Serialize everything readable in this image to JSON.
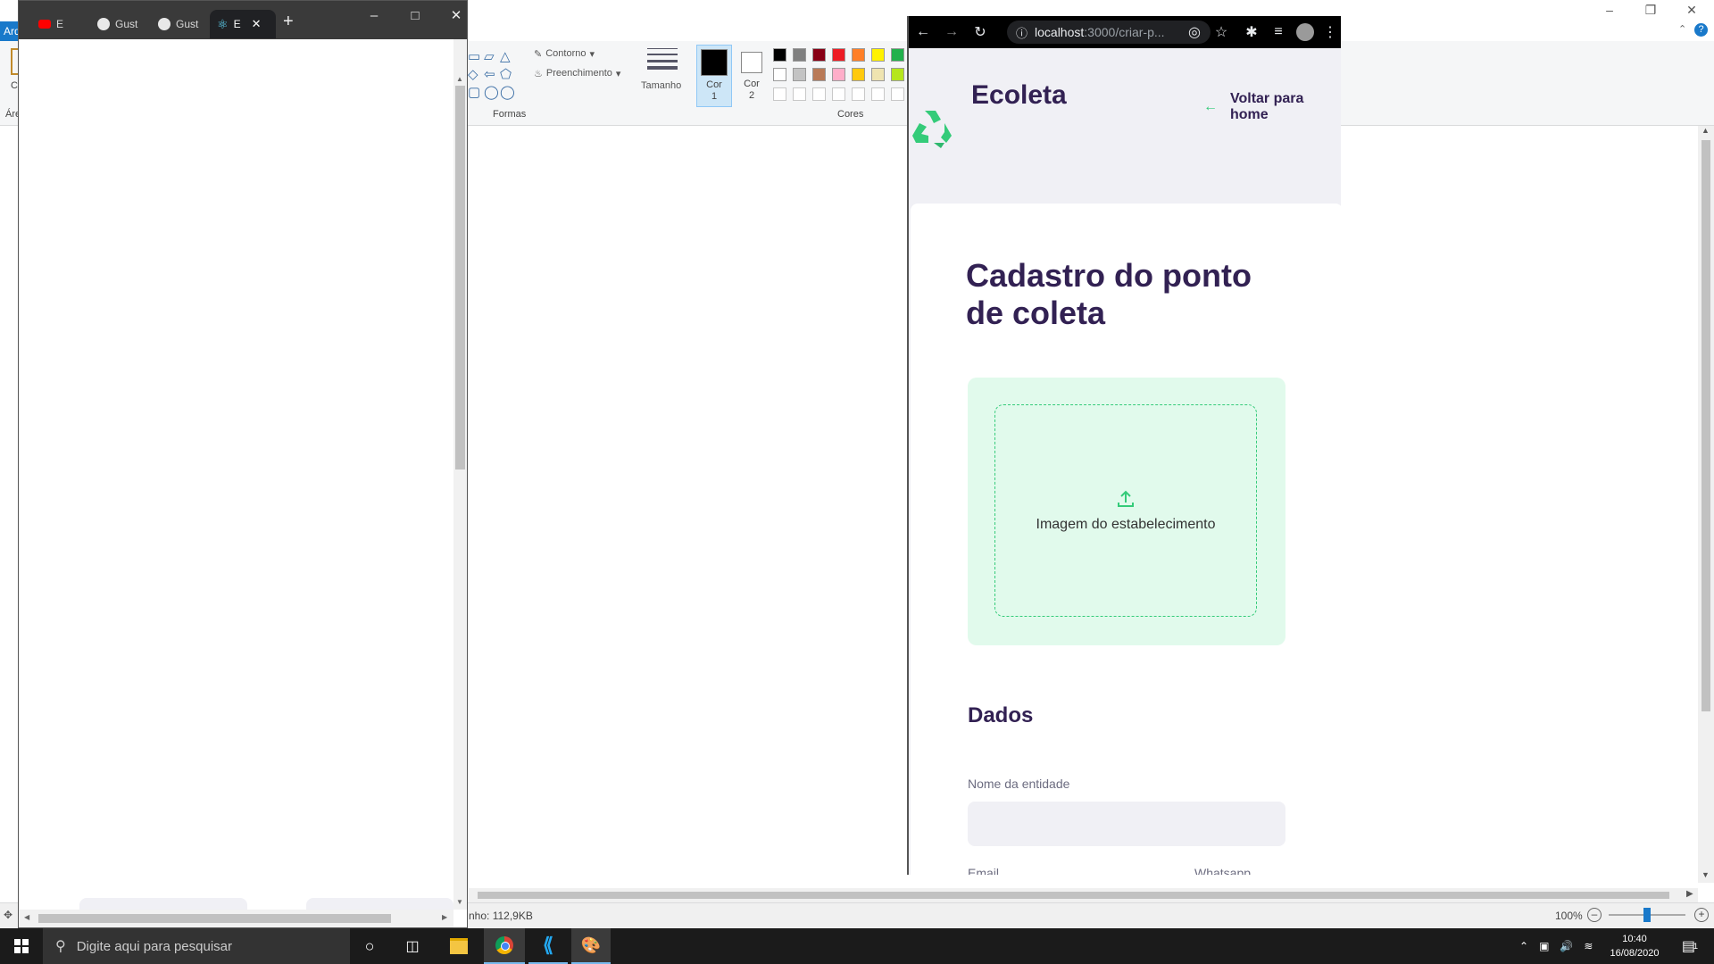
{
  "paint": {
    "file_tab": "Arq",
    "area_label": "Áre",
    "clip_letter": "C",
    "contour_label": "Contorno",
    "fill_label": "Preenchimento",
    "shapes_group": "Formas",
    "size_label": "Tamanho",
    "color1_label": "Cor 1",
    "color2_label": "Cor 2",
    "colors_group": "Cores",
    "status_size": "nho: 112,9KB",
    "zoom": "100%",
    "zoom_level_fraction": 0.5,
    "palette_row1": [
      "#000000",
      "#7f7f7f",
      "#880015",
      "#ed1c24",
      "#ff7f27",
      "#fff200",
      "#22b14c"
    ],
    "palette_row2": [
      "#ffffff",
      "#c3c3c3",
      "#b97a57",
      "#ffaec9",
      "#ffc90e",
      "#efe4b0",
      "#b5e61d"
    ]
  },
  "chrome_left": {
    "tabs": [
      {
        "label": "E",
        "icon": "youtube-icon"
      },
      {
        "label": "Gust",
        "icon": "github-icon"
      },
      {
        "label": "Gust",
        "icon": "github-icon"
      },
      {
        "label": "E",
        "icon": "react-icon",
        "active": true
      }
    ],
    "new_tab": "+"
  },
  "chrome_right": {
    "url_host": "localhost",
    "url_path": ":3000/criar-p...",
    "page": {
      "logo": "Ecoleta",
      "back_link": "Voltar para home",
      "title": "Cadastro do ponto de coleta",
      "dropzone_text": "Imagem do estabelecimento",
      "section_dados": "Dados",
      "label_nome": "Nome da entidade",
      "label_email": "Email",
      "label_whatsapp": "Whatsapp"
    },
    "colors": {
      "primary": "#34cb79",
      "title": "#322153",
      "bg": "#f0f0f5"
    }
  },
  "taskbar": {
    "search_placeholder": "Digite aqui para pesquisar",
    "time": "10:40",
    "date": "16/08/2020",
    "notification_count": "1"
  }
}
